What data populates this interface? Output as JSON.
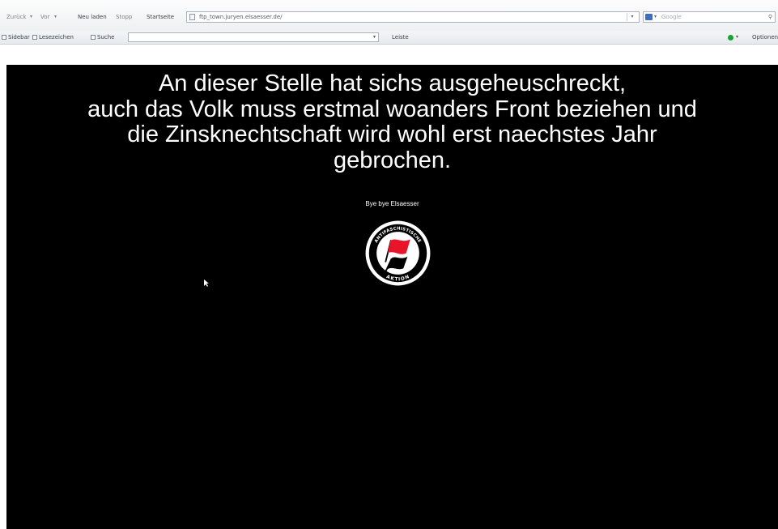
{
  "colors": {
    "page_background": "#000000",
    "text": "#ffffff",
    "flag_red": "#e8142a",
    "flag_black": "#000000",
    "status_green": "#12a62e"
  },
  "toolbar": {
    "back_label": "Zurück",
    "forward_label": "Vor",
    "reload_label": "Neu laden",
    "stop_label": "Stopp",
    "home_label": "Startseite",
    "url": "ftp_town.juryen.elsaesser.de/",
    "search_placeholder": "Google",
    "search_engine_icon": "google-icon"
  },
  "bookmarks_bar": {
    "sidebar_label": "Sidebar",
    "bookmark_label": "Lesezeichen",
    "search_label": "Suche",
    "select_value": "Leiste",
    "options_label": "Optionen"
  },
  "page": {
    "headline_lines": [
      "An dieser Stelle hat sichs ausgeheuschreckt,",
      "auch das Volk muss erstmal woanders Front beziehen und",
      "die Zinsknechtschaft wird wohl erst naechstes Jahr",
      "gebrochen."
    ],
    "byline": "Bye bye Elsaesser",
    "logo": {
      "icon": "antifa-flag-logo",
      "top_text": "ANTIFASCHISTISCHE",
      "bottom_text": "AKTION"
    }
  }
}
